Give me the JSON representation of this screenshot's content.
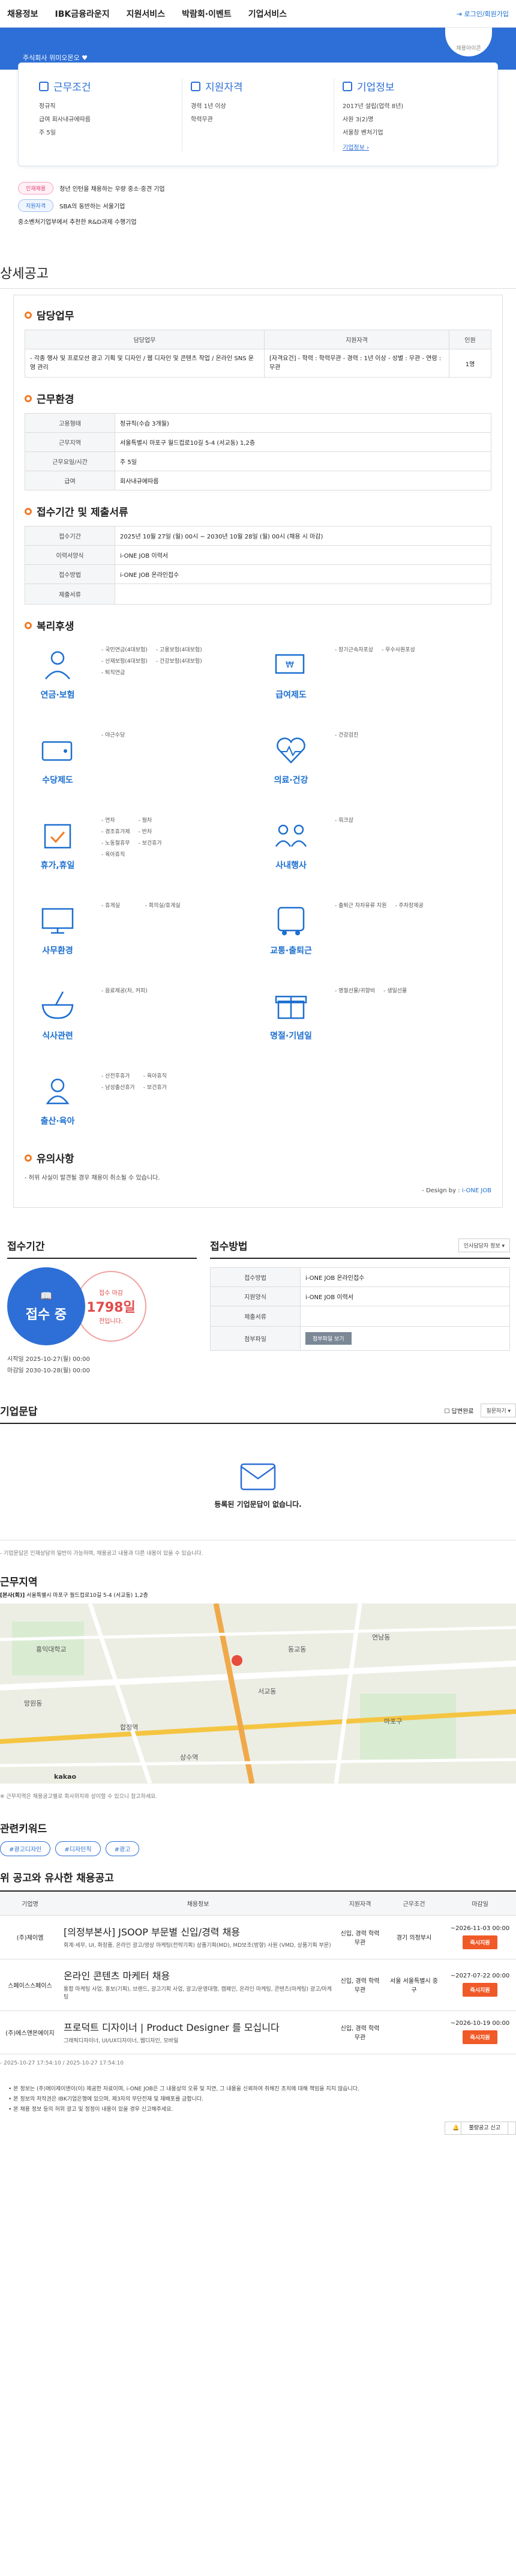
{
  "nav": {
    "items": [
      "채용정보",
      "IBK금융라운지",
      "지원서비스",
      "박람회·이벤트",
      "기업서비스"
    ],
    "login": "로그인/회원가입"
  },
  "hero": {
    "logo_text": "채용아이콘",
    "tagline": "주식회사 위미오몬오"
  },
  "cards": [
    {
      "title": "근무조건",
      "rows": [
        "정규직",
        "급여 회사내규에따름",
        "주 5일"
      ]
    },
    {
      "title": "지원자격",
      "rows": [
        "경력 1년 이상",
        "학력무관"
      ]
    },
    {
      "title": "기업정보",
      "rows": [
        "2017년 설립(업력 8년)",
        "사원 3(2)명",
        "서울창 벤처기업"
      ],
      "link": "기업정보"
    }
  ],
  "badges": [
    {
      "pill": "인재채용",
      "text": "청년 인턴을 채용하는 우량 중소·중견 기업"
    },
    {
      "pill": "지원자격",
      "text": "SBA의 동반하는 서울기업"
    },
    {
      "pill": "",
      "text": "중소벤처기업부에서 추천한 R&D과제 수행기업"
    }
  ],
  "section": {
    "title": "상세공고",
    "duty": {
      "heading": "담당업무",
      "cols": [
        "담당업무",
        "지원자격",
        "인원"
      ],
      "row": {
        "duty": "- 각종 행사 및 프로모션 광고 기획 및 디자인 / 웹 디자인 및 콘텐츠 작업 / 온라인 SNS 운영 관리",
        "qual": "[자격요건] - 학력 : 학력무관 - 경력 : 1년 이상 - 성별 : 무관 - 연령 : 무관",
        "count": "1명"
      }
    },
    "env": {
      "heading": "근무환경",
      "rows": [
        {
          "k": "고용형태",
          "v": "정규직(수습 3개월)"
        },
        {
          "k": "근무지역",
          "v": "서울특별시 마포구 월드컵로10길 5-4 (서교동) 1,2층"
        },
        {
          "k": "근무요일/시간",
          "v": "주 5일"
        },
        {
          "k": "급여",
          "v": "회사내규에따름"
        }
      ]
    },
    "apply_info": {
      "heading": "접수기간 및 제출서류",
      "rows": [
        {
          "k": "접수기간",
          "v": "2025년 10월 27일 (월) 00시 ~ 2030년 10월 28일 (월) 00시 (채용 시 마감)"
        },
        {
          "k": "이력서양식",
          "v": "i-ONE JOB 이력서"
        },
        {
          "k": "접수방법",
          "v": "i-ONE JOB 온라인접수"
        },
        {
          "k": "제출서류",
          "v": ""
        }
      ]
    },
    "benefits": {
      "heading": "복리후생",
      "items": [
        {
          "label": "연금·보험",
          "icon": "umbrella-person-icon",
          "list": [
            "국민연금(4대보험)",
            "고용보험(4대보험)",
            "산재보험(4대보험)",
            "건강보험(4대보험)",
            "퇴직연금"
          ]
        },
        {
          "label": "급여제도",
          "icon": "money-card-icon",
          "list": [
            "장기근속자포상",
            "우수사원포상"
          ]
        },
        {
          "label": "수당제도",
          "icon": "wallet-icon",
          "list": [
            "야근수당"
          ]
        },
        {
          "label": "의료·건강",
          "icon": "heart-pulse-icon",
          "list": [
            "건강검진"
          ]
        },
        {
          "label": "휴가,휴일",
          "icon": "calendar-check-icon",
          "list": [
            "연차",
            "월차",
            "경조휴가제",
            "반차",
            "노동절휴무",
            "보건휴가",
            "육아휴직"
          ]
        },
        {
          "label": "사내행사",
          "icon": "people-group-icon",
          "list": [
            "워크샵"
          ]
        },
        {
          "label": "사무환경",
          "icon": "monitor-icon",
          "list": [
            "휴게실",
            "회의실/휴게실"
          ]
        },
        {
          "label": "교통·출퇴근",
          "icon": "bus-icon",
          "list": [
            "출퇴근 자차유류 지원",
            "주차장제공"
          ]
        },
        {
          "label": "식사관련",
          "icon": "rice-bowl-icon",
          "list": [
            "음료제공(차, 커피)"
          ]
        },
        {
          "label": "명절·기념일",
          "icon": "gift-icon",
          "list": [
            "명절선물/귀향비",
            "생일선물"
          ]
        },
        {
          "label": "출산·육아",
          "icon": "baby-bottle-icon",
          "list": [
            "산전후휴가",
            "육아휴직",
            "남성출산휴가",
            "보건휴가"
          ]
        }
      ]
    },
    "caution": {
      "heading": "유의사항",
      "text": "- 허위 사실이 발견될 경우 채용이 취소될 수 있습니다."
    },
    "design_credit": {
      "prefix": "- Design by :",
      "brand": "i-ONE JOB"
    }
  },
  "apply": {
    "period_title": "접수기간",
    "status": "접수 중",
    "dday_label": "접수 마감",
    "dday_value": "1798일",
    "dday_suffix": "전입니다.",
    "start": "시작일 2025-10-27(월) 00:00",
    "end": "마감일 2030-10-28(월) 00:00",
    "method_title": "접수방법",
    "select": "인사담당자 정보",
    "rows": [
      {
        "k": "접수방법",
        "v": "i-ONE JOB 온라인접수"
      },
      {
        "k": "지원양식",
        "v": "i-ONE JOB 이력서"
      },
      {
        "k": "제출서류",
        "v": ""
      },
      {
        "k": "첨부파일",
        "v": ""
      }
    ],
    "attach_button": "첨부파일 보기"
  },
  "qa": {
    "title": "기업문답",
    "check_label": "답변완료",
    "sort": "질문하기",
    "empty": "등록된 기업문답이 없습니다.",
    "note": "- 기업문답은 인재상담의 일반이 가능하며, 채용공고 내용과 다른 내용이 있을 수 있습니다."
  },
  "location": {
    "title": "근무지역",
    "addr_label": "[본사(회)]",
    "addr": "서울특별시 마포구 월드컵로10길 5-4 (서교동) 1,2층",
    "note": "※ 근무지역은 채용공고별로 회사위치와 상이할 수 있으니 참고하세요.",
    "map_labels": [
      "홍익대학교",
      "서교동",
      "합정역",
      "마포구",
      "망원동",
      "연남동",
      "동교동",
      "상수역"
    ],
    "map_brand": "kakao"
  },
  "keywords": {
    "title": "관련키워드",
    "items": [
      "#광고디자인",
      "#디자인직",
      "#광고"
    ]
  },
  "similar": {
    "title": "위 공고와 유사한 채용공고",
    "cols": [
      "기업명",
      "채용정보",
      "지원자격",
      "근무조건",
      "마감일"
    ],
    "rows": [
      {
        "company": "(주)제이엠",
        "title": "[의정부본사] JSOOP 부문별 신입/경력 채용",
        "desc": "회계·세무, UI, 화장품, 온라인 광고/영상 마케팅(전략기획) 상품기획(MD), MD보조(방향) 사원 (VMD, 상품기획 부문)",
        "qual": "신입, 경력 학력무관",
        "cond": "경기 의정부시",
        "deadline": "~2026-11-03 00:00",
        "btn": "즉시지원"
      },
      {
        "company": "스페이스스페이스",
        "title": "온라인 콘텐츠 마케터 채용",
        "desc": "통합 마케팅 사업, 홍보(기획), 브랜드, 광고기획 사업, 광고/운영대행, 캠페인, 온라인 마케팅, 콘텐츠(마케팅) 광고/마케팅",
        "qual": "신입, 경력 학력무관",
        "cond": "서울 서울특별시 중구",
        "deadline": "~2027-07-22 00:00",
        "btn": "즉시지원"
      },
      {
        "company": "(주)에스앤몬에이지",
        "title": "프로덕트 디자이너 | Product Designer 를 모십니다",
        "desc": "그래픽디자이너, UI/UX디자이너, 웹디자인, 모바일",
        "qual": "신입, 경력 학력무관",
        "cond": "",
        "deadline": "~2026-10-19 00:00",
        "btn": "즉시지원"
      }
    ]
  },
  "footer": {
    "meta": "- 2025-10-27 17:54:10 / 2025-10-27 17:54:10",
    "notes": [
      "본 정보는 (주)에이제이앤이(이) 제공한 자료이며, i-ONE JOB은 그 내용상의 오류 및 지연, 그 내용을 신뢰하여 취해진 조치에 대해 책임을 지지 않습니다.",
      "본 정보의 저작권은 IBK기업은행에 있으며, 제3자의 무단전재 및 재배포를 금합니다.",
      "본 채용 정보 등의 허위 광고 및 정정이 내용이 있을 경우 신고해주세요."
    ],
    "report": "불량공고 신고"
  },
  "colors": {
    "primary": "#2d6fd6",
    "accent": "#f05a28",
    "danger": "#e14b4b"
  }
}
